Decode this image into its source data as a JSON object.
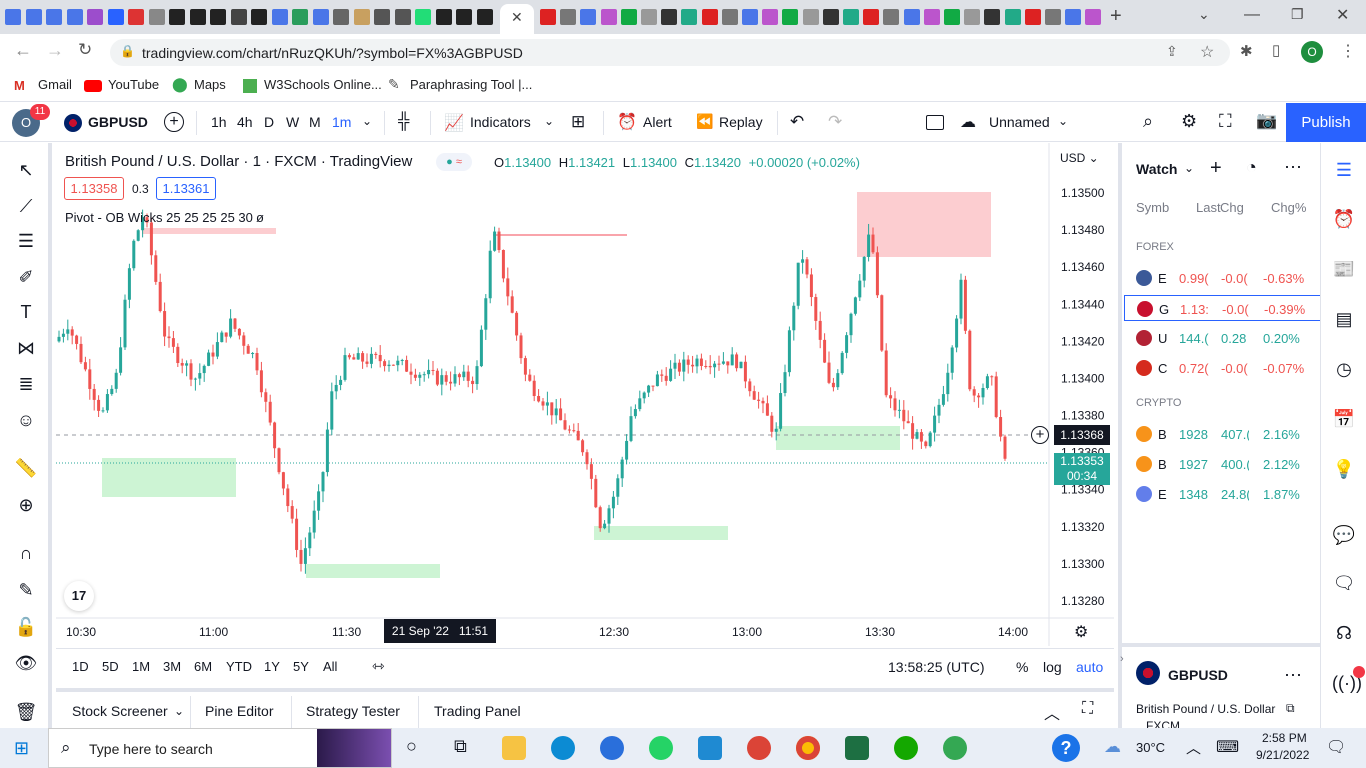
{
  "browser": {
    "url": "tradingview.com/chart/nRuzQKUh/?symbol=FX%3AGBPUSD",
    "avatar_letter": "O",
    "bookmarks": [
      "Gmail",
      "YouTube",
      "Maps",
      "W3Schools Online...",
      "Paraphrasing Tool |..."
    ]
  },
  "toolbar": {
    "notif_count": "11",
    "avatar_letter": "O",
    "symbol": "GBPUSD",
    "intervals": [
      "1h",
      "4h",
      "D",
      "W",
      "M",
      "1m"
    ],
    "indicators": "Indicators",
    "alert": "Alert",
    "replay": "Replay",
    "layout_name": "Unnamed",
    "publish": "Publish"
  },
  "legend": {
    "title": "British Pound / U.S. Dollar · 1 · FXCM · TradingView",
    "o_label": "O",
    "o": "1.13400",
    "h_label": "H",
    "h": "1.13421",
    "l_label": "L",
    "l": "1.13400",
    "c_label": "C",
    "c": "1.13420",
    "change": "+0.00020 (+0.02%)",
    "bid": "1.13358",
    "spread": "0.3",
    "ask": "1.13361",
    "indicator": "Pivot - OB Wicks 25 25 25 25 30",
    "indicator_value": "ø"
  },
  "chart_data": {
    "type": "candlestick",
    "currency": "USD",
    "price_ticks": [
      "1.13500",
      "1.13480",
      "1.13460",
      "1.13440",
      "1.13420",
      "1.13400",
      "1.13380",
      "1.13360",
      "1.13340",
      "1.13320",
      "1.13300",
      "1.13280"
    ],
    "ylim": [
      1.13275,
      1.13505
    ],
    "time_ticks": [
      "10:30",
      "11:00",
      "11:30",
      "12:30",
      "13:00",
      "13:30",
      "14:00"
    ],
    "crosshair_time": "21 Sep '22   11:51",
    "crosshair_price": "1.13368",
    "last_price": "1.13353",
    "countdown": "00:34",
    "bull_color": "#26a69a",
    "bear_color": "#ef5350"
  },
  "bottom": {
    "ranges": [
      "1D",
      "5D",
      "1M",
      "3M",
      "6M",
      "YTD",
      "1Y",
      "5Y",
      "All"
    ],
    "clock": "13:58:25 (UTC)",
    "pct": "%",
    "log": "log",
    "auto": "auto"
  },
  "panels": [
    "Stock Screener",
    "Pine Editor",
    "Strategy Tester",
    "Trading Panel"
  ],
  "watchlist": {
    "title": "Watch",
    "cols": [
      "Symb",
      "Last",
      "Chg",
      "Chg%"
    ],
    "forex_header": "FOREX",
    "forex": [
      {
        "sym": "E",
        "last": "0.99(",
        "chg": "-0.0(",
        "pct": "-0.63%",
        "up": false
      },
      {
        "sym": "G",
        "last": "1.13:",
        "chg": "-0.0(",
        "pct": "-0.39%",
        "up": false
      },
      {
        "sym": "U",
        "last": "144.(",
        "chg": "0.28",
        "pct": "0.20%",
        "up": true
      },
      {
        "sym": "C",
        "last": "0.72(",
        "chg": "-0.0(",
        "pct": "-0.07%",
        "up": false
      }
    ],
    "crypto_header": "CRYPTO",
    "crypto": [
      {
        "sym": "B",
        "last": "1928!",
        "chg": "407.(",
        "pct": "2.16%",
        "up": true
      },
      {
        "sym": "B",
        "last": "1927!",
        "chg": "400.(",
        "pct": "2.12%",
        "up": true
      },
      {
        "sym": "E",
        "last": "1348",
        "chg": "24.8(",
        "pct": "1.87%",
        "up": true
      }
    ],
    "detail_symbol": "GBPUSD",
    "detail_name": "British Pound / U.S. Dollar",
    "detail_exchange": "FXCM"
  },
  "taskbar": {
    "search_placeholder": "Type here to search",
    "temp": "30°C",
    "time": "2:58 PM",
    "date": "9/21/2022"
  }
}
